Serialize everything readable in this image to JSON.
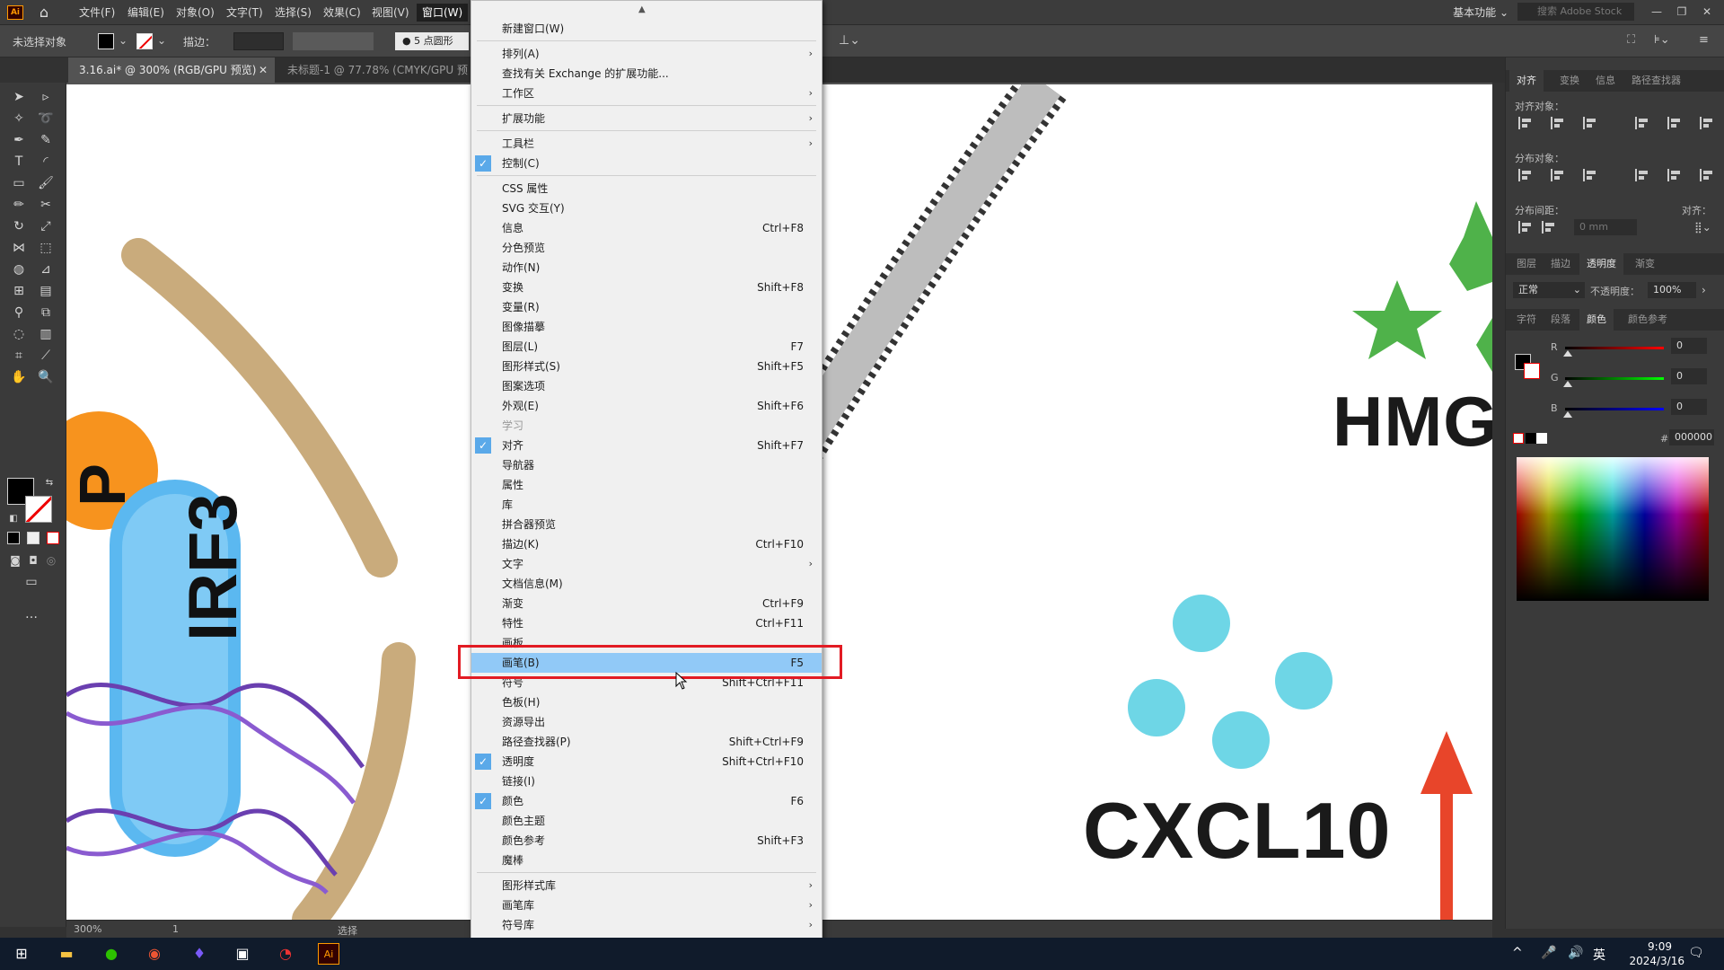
{
  "app": {
    "logo": "Ai",
    "home_icon": "home-icon"
  },
  "menubar": {
    "items": [
      "文件(F)",
      "编辑(E)",
      "对象(O)",
      "文字(T)",
      "选择(S)",
      "效果(C)",
      "视图(V)",
      "窗口(W)"
    ],
    "workspace": "基本功能",
    "search_placeholder": "搜索 Adobe Stock"
  },
  "controlbar": {
    "no_selection": "未选择对象",
    "stroke_label": "描边：",
    "brush": "● 5 点圆形"
  },
  "doc_tabs": [
    {
      "label": "3.16.ai* @ 300% (RGB/GPU 预览)",
      "active": true
    },
    {
      "label": "未标题-1 @ 77.78% (CMYK/GPU 预",
      "active": false
    }
  ],
  "canvas": {
    "labels": {
      "hmg": "HMG",
      "cxcl10": "CXCL10",
      "irf3": "IRF3",
      "p": "P"
    },
    "colors": {
      "arc": "#c9ab7c",
      "membrane": "#b9b9b9",
      "orange": "#f7931e",
      "irf3_body": "#5bb8f0",
      "cyan": "#6ed6e6",
      "arrow": "#e8452a",
      "star": "#4fb24a"
    }
  },
  "statusbar": {
    "zoom": "300%",
    "page": "1",
    "status": "选择"
  },
  "panels": {
    "top_tabs": [
      "对齐",
      "变换",
      "信息",
      "路径查找器"
    ],
    "align_objects": "对齐对象：",
    "distribute_objects": "分布对象：",
    "distribute_spacing": "分布间距：",
    "align_to": "对齐：",
    "spacing_value": "0 mm",
    "mid_tabs": [
      "图层",
      "描边",
      "透明度",
      "渐变"
    ],
    "blend_mode": "正常",
    "opacity_label": "不透明度：",
    "opacity_value": "100%",
    "color_tabs": [
      "字符",
      "段落",
      "颜色",
      "颜色参考"
    ],
    "r_label": "R",
    "g_label": "G",
    "b_label": "B",
    "r_value": "0",
    "g_value": "0",
    "b_value": "0",
    "hex_label": "#",
    "hex_value": "000000"
  },
  "window_menu": {
    "items": [
      {
        "label": "新建窗口(W)"
      },
      {
        "sep": true
      },
      {
        "label": "排列(A)",
        "submenu": true
      },
      {
        "label": "查找有关 Exchange 的扩展功能..."
      },
      {
        "label": "工作区",
        "submenu": true
      },
      {
        "sep": true
      },
      {
        "label": "扩展功能",
        "submenu": true
      },
      {
        "sep": true
      },
      {
        "label": "工具栏",
        "submenu": true
      },
      {
        "label": "控制(C)",
        "checked": true
      },
      {
        "sep": true
      },
      {
        "label": "CSS 属性"
      },
      {
        "label": "SVG 交互(Y)"
      },
      {
        "label": "信息",
        "shortcut": "Ctrl+F8"
      },
      {
        "label": "分色预览"
      },
      {
        "label": "动作(N)"
      },
      {
        "label": "变换",
        "shortcut": "Shift+F8"
      },
      {
        "label": "变量(R)"
      },
      {
        "label": "图像描摹"
      },
      {
        "label": "图层(L)",
        "shortcut": "F7"
      },
      {
        "label": "图形样式(S)",
        "shortcut": "Shift+F5"
      },
      {
        "label": "图案选项"
      },
      {
        "label": "外观(E)",
        "shortcut": "Shift+F6"
      },
      {
        "label": "学习",
        "disabled": true
      },
      {
        "label": "对齐",
        "shortcut": "Shift+F7",
        "checked": true
      },
      {
        "label": "导航器"
      },
      {
        "label": "属性"
      },
      {
        "label": "库"
      },
      {
        "label": "拼合器预览"
      },
      {
        "label": "描边(K)",
        "shortcut": "Ctrl+F10"
      },
      {
        "label": "文字",
        "submenu": true
      },
      {
        "label": "文档信息(M)"
      },
      {
        "label": "渐变",
        "shortcut": "Ctrl+F9"
      },
      {
        "label": "特性",
        "shortcut": "Ctrl+F11"
      },
      {
        "label": "画板"
      },
      {
        "label": "画笔(B)",
        "shortcut": "F5",
        "highlighted": true
      },
      {
        "label": "符号",
        "shortcut": "Shift+Ctrl+F11"
      },
      {
        "label": "色板(H)"
      },
      {
        "label": "资源导出"
      },
      {
        "label": "路径查找器(P)",
        "shortcut": "Shift+Ctrl+F9"
      },
      {
        "label": "透明度",
        "shortcut": "Shift+Ctrl+F10",
        "checked": true
      },
      {
        "label": "链接(I)"
      },
      {
        "label": "颜色",
        "shortcut": "F6",
        "checked": true
      },
      {
        "label": "颜色主题"
      },
      {
        "label": "颜色参考",
        "shortcut": "Shift+F3"
      },
      {
        "label": "魔棒"
      },
      {
        "sep": true
      },
      {
        "label": "图形样式库",
        "submenu": true
      },
      {
        "label": "画笔库",
        "submenu": true
      },
      {
        "label": "符号库",
        "submenu": true
      }
    ],
    "checkmark": "✓",
    "submenu_arrow": "›"
  },
  "taskbar": {
    "time": "9:09",
    "date": "2024/3/16",
    "ime": "英"
  }
}
